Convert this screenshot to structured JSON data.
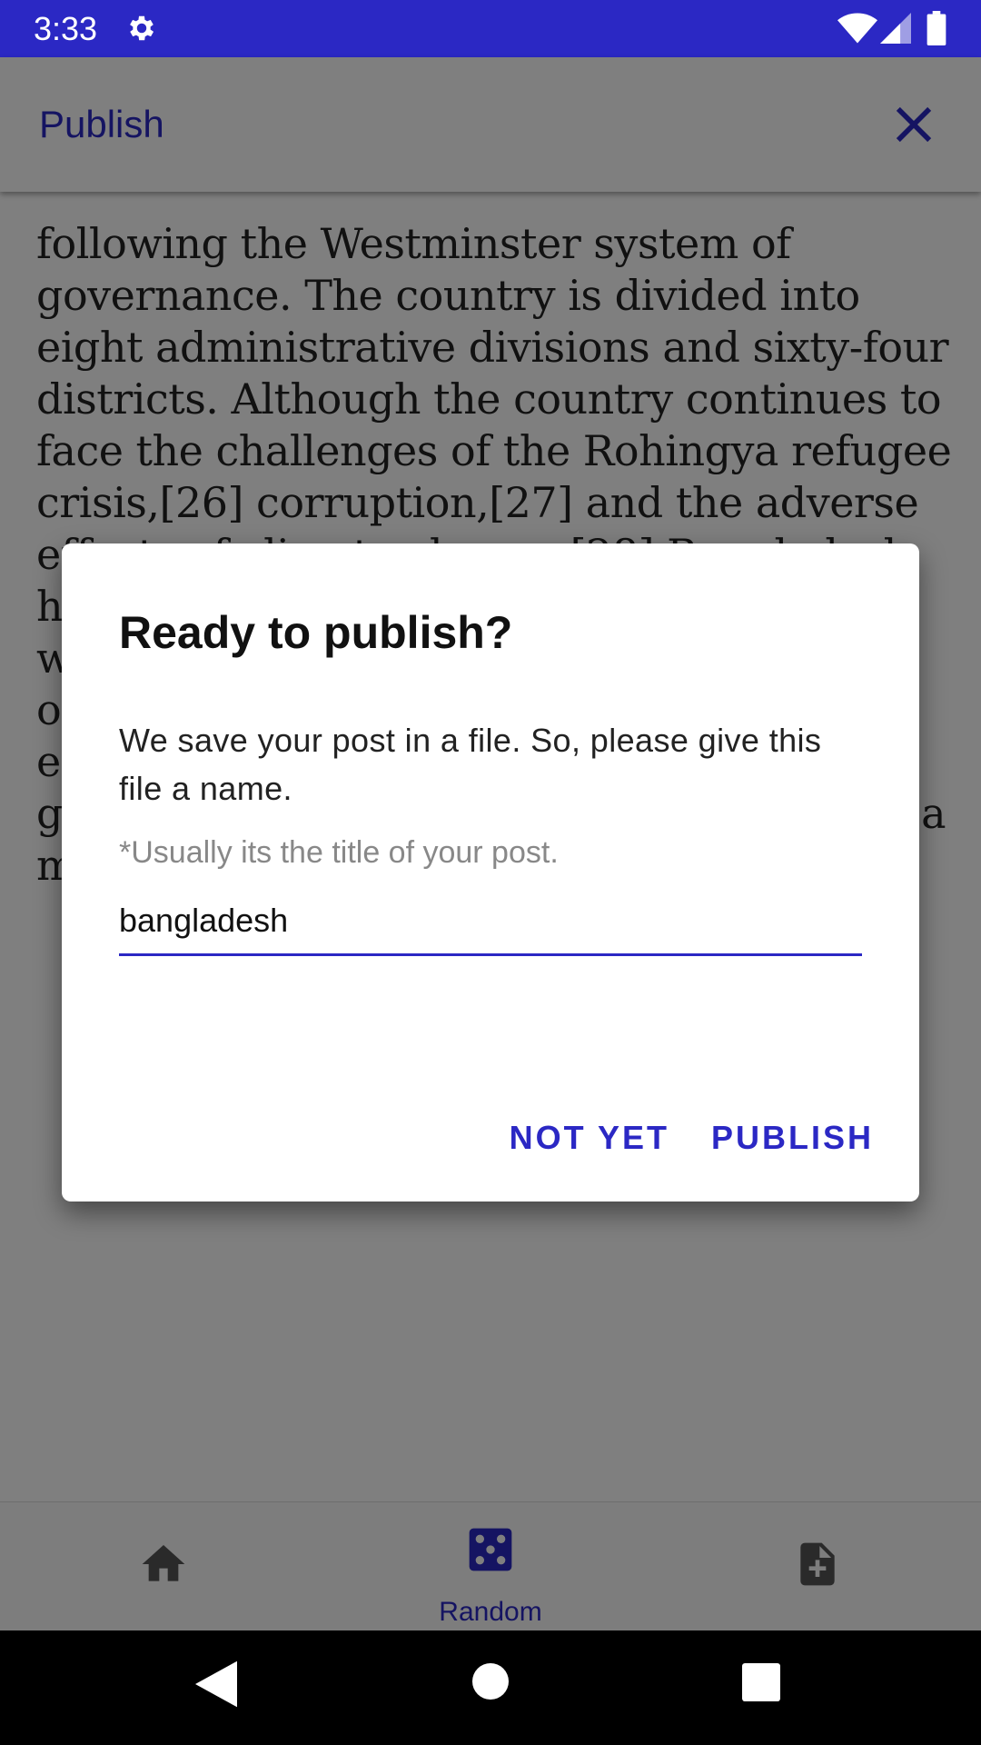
{
  "status_bar": {
    "time": "3:33",
    "icons": [
      "gear-icon",
      "wifi-icon",
      "signal-icon",
      "battery-icon"
    ],
    "background": "#2b28c4"
  },
  "app_bar": {
    "title": "Publish",
    "close_icon": "close-icon",
    "accent": "#2b28c4"
  },
  "article": {
    "text": "following the Westminster system of governance. The country is divided into eight administrative divisions and sixty-four districts. Although the country continues to face the challenges of the Rohingya refugee crisis,[26] corruption,[27] and the adverse effects of climate change,[28] Bangladesh has made significant progress and strides with a growing economy; it is considered one of the world's fastest-growing economies and one of the emerging and growth-leading economies. The country is a member of the G"
  },
  "dialog": {
    "title": "Ready to publish?",
    "message": "We save your post in a file. So, please give this file a name.",
    "hint": "*Usually its the title of your post.",
    "input_value": "bangladesh",
    "not_yet_label": "NOT YET",
    "publish_label": "PUBLISH"
  },
  "bottom_nav": {
    "items": [
      {
        "icon": "home-icon",
        "label": ""
      },
      {
        "icon": "dice-icon",
        "label": "Random",
        "selected": true
      },
      {
        "icon": "new-file-icon",
        "label": ""
      }
    ]
  },
  "system_nav": {
    "icons": [
      "back-icon",
      "home-circle-icon",
      "recents-icon"
    ]
  }
}
